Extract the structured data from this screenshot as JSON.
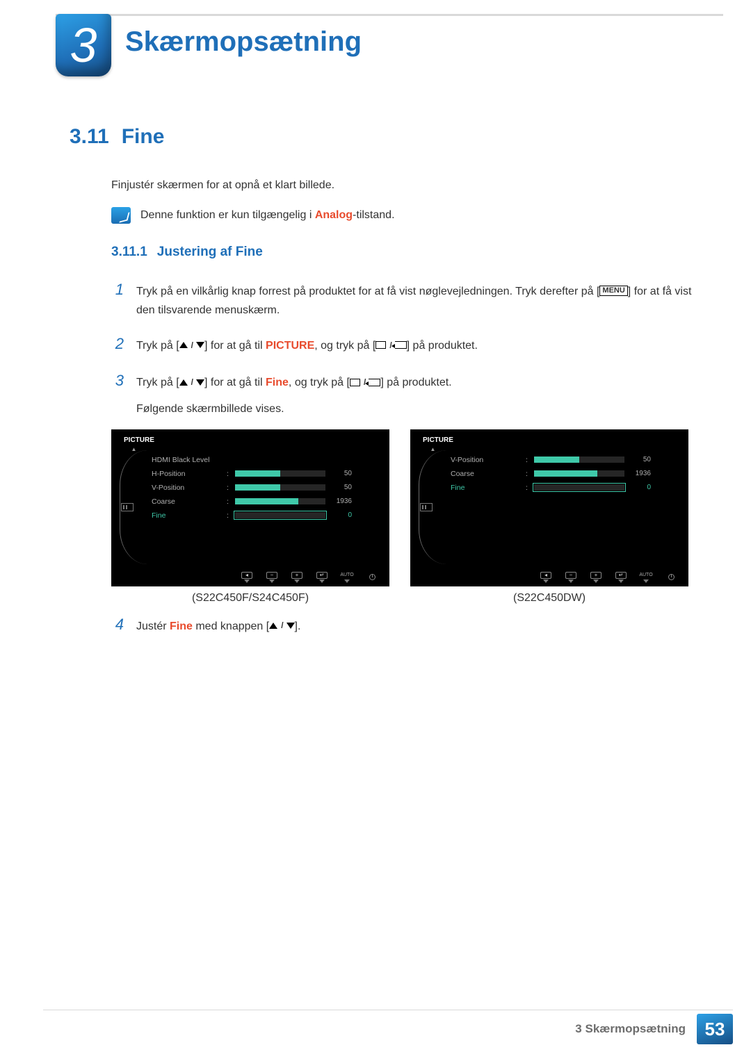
{
  "chapter": {
    "number": "3",
    "title": "Skærmopsætning"
  },
  "section": {
    "number": "3.11",
    "title": "Fine"
  },
  "intro": "Finjustér skærmen for at opnå et klart billede.",
  "note": {
    "pre": "Denne funktion er kun tilgængelig i ",
    "hl": "Analog",
    "post": "-tilstand."
  },
  "subsection": {
    "number": "3.11.1",
    "title": "Justering af Fine"
  },
  "steps": {
    "s1a": "Tryk på en vilkårlig knap forrest på produktet for at få vist nøglevejledningen. Tryk derefter på [",
    "s1menu": "MENU",
    "s1b": "] for at få vist den tilsvarende menuskærm.",
    "s2a": "Tryk på [",
    "s2b": "] for at gå til ",
    "s2hl": "PICTURE",
    "s2c": ", og tryk på [",
    "s2d": "] på produktet.",
    "s3a": "Tryk på [",
    "s3b": "] for at gå til ",
    "s3hl": "Fine",
    "s3c": ", og tryk på [",
    "s3d": "] på produktet.",
    "s3e": "Følgende skærmbillede vises.",
    "s4a": "Justér ",
    "s4hl": "Fine",
    "s4b": " med knappen [",
    "s4c": "]."
  },
  "osd": {
    "left": {
      "title": "PICTURE",
      "rows": [
        {
          "label": "HDMI Black Level",
          "value": "",
          "pct": 0,
          "selected": false,
          "bar": false
        },
        {
          "label": "H-Position",
          "value": "50",
          "pct": 50,
          "selected": false,
          "bar": true
        },
        {
          "label": "V-Position",
          "value": "50",
          "pct": 50,
          "selected": false,
          "bar": true
        },
        {
          "label": "Coarse",
          "value": "1936",
          "pct": 70,
          "selected": false,
          "bar": true
        },
        {
          "label": "Fine",
          "value": "0",
          "pct": 0,
          "selected": true,
          "bar": true
        }
      ],
      "caption": "(S22C450F/S24C450F)"
    },
    "right": {
      "title": "PICTURE",
      "rows": [
        {
          "label": "V-Position",
          "value": "50",
          "pct": 50,
          "selected": false,
          "bar": true
        },
        {
          "label": "Coarse",
          "value": "1936",
          "pct": 70,
          "selected": false,
          "bar": true
        },
        {
          "label": "Fine",
          "value": "0",
          "pct": 0,
          "selected": true,
          "bar": true
        }
      ],
      "caption": "(S22C450DW)"
    },
    "footer_auto": "AUTO"
  },
  "footer": {
    "text": "3 Skærmopsætning",
    "page": "53"
  }
}
